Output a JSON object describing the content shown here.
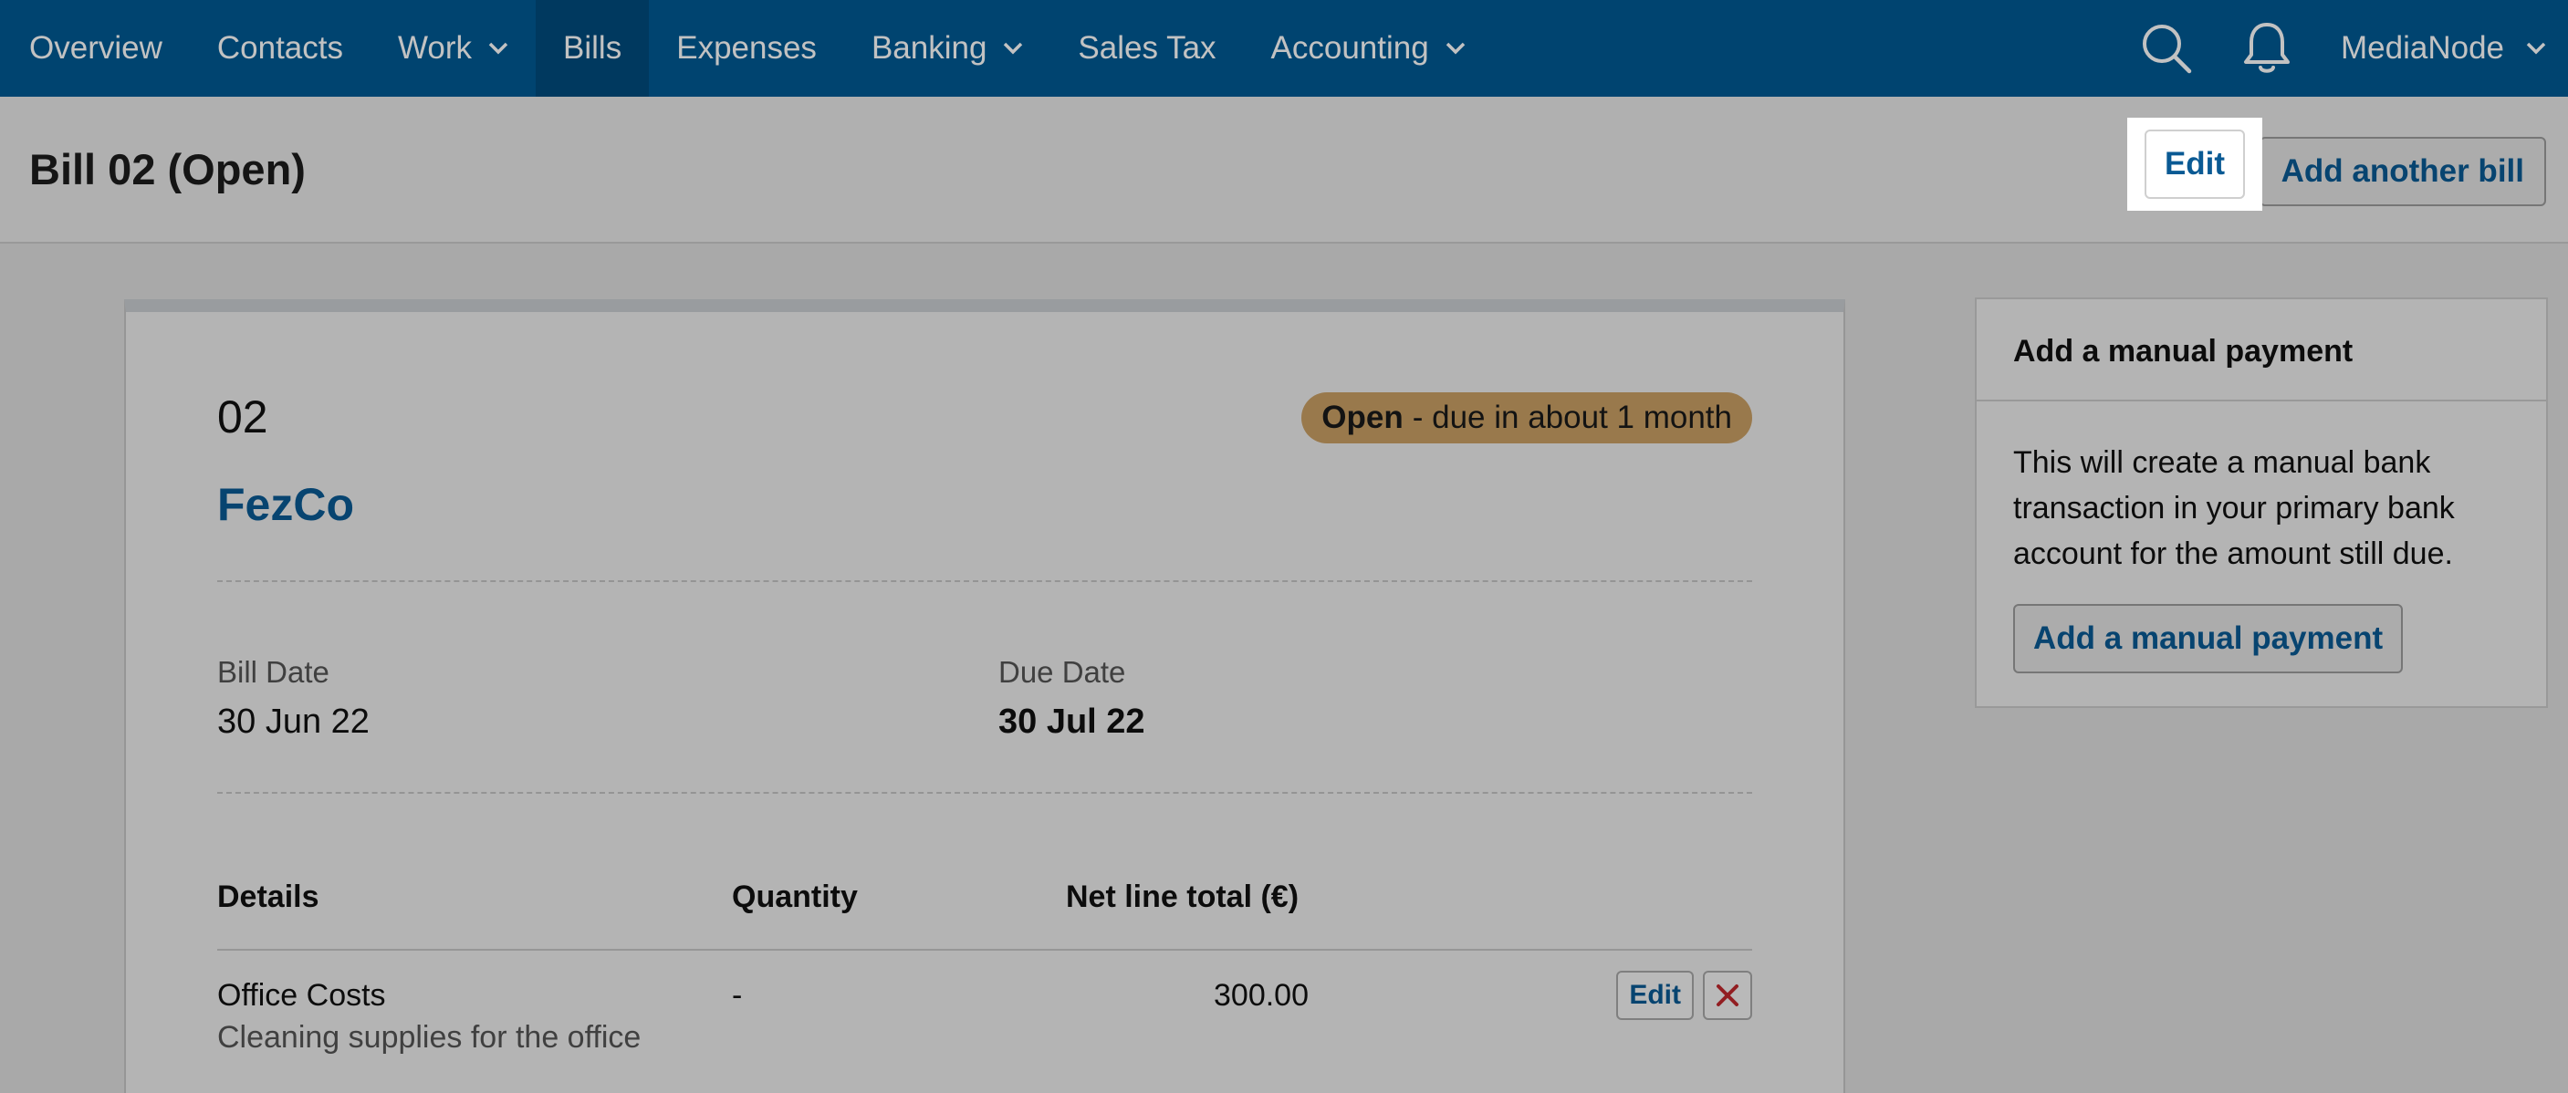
{
  "nav": {
    "items": [
      {
        "label": "Overview",
        "has_dropdown": false,
        "active": false
      },
      {
        "label": "Contacts",
        "has_dropdown": false,
        "active": false
      },
      {
        "label": "Work",
        "has_dropdown": true,
        "active": false
      },
      {
        "label": "Bills",
        "has_dropdown": false,
        "active": true
      },
      {
        "label": "Expenses",
        "has_dropdown": false,
        "active": false
      },
      {
        "label": "Banking",
        "has_dropdown": true,
        "active": false
      },
      {
        "label": "Sales Tax",
        "has_dropdown": false,
        "active": false
      },
      {
        "label": "Accounting",
        "has_dropdown": true,
        "active": false
      }
    ],
    "search_icon": "search-icon",
    "notifications_icon": "bell-icon",
    "account_name": "MediaNode"
  },
  "header": {
    "title": "Bill 02 (Open)",
    "edit_label": "Edit",
    "add_another_label": "Add another bill"
  },
  "bill": {
    "number": "02",
    "status": "Open",
    "status_detail": "- due in about 1 month",
    "contact": "FezCo",
    "bill_date_label": "Bill Date",
    "bill_date": "30 Jun 22",
    "due_date_label": "Due Date",
    "due_date": "30 Jul 22",
    "table": {
      "headers": [
        "Details",
        "Quantity",
        "Net line total (€)"
      ],
      "rows": [
        {
          "detail": "Office Costs",
          "description": "Cleaning supplies for the office",
          "quantity": "-",
          "net_total": "300.00",
          "edit_label": "Edit"
        }
      ]
    }
  },
  "side_panel": {
    "title": "Add a manual payment",
    "text": "This will create a manual bank transaction in your primary bank account for the amount still due.",
    "button_label": "Add a manual payment"
  },
  "colors": {
    "nav_bg": "#005a94",
    "nav_active_bg": "#004b7d",
    "link": "#0a5a94",
    "status_badge": "#c9a065",
    "delete": "#c0282d"
  }
}
